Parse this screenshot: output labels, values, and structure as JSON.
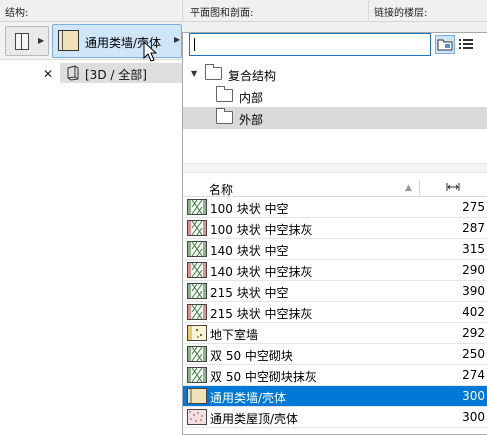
{
  "headers": {
    "structure": "结构:",
    "floorplan": "平面图和剖面:",
    "linked_stories": "链接的楼层:"
  },
  "toolbar": {
    "composite_name": "通用类墙/壳体"
  },
  "story": {
    "label": "[3D / 全部]"
  },
  "popup": {
    "search": {
      "value": "",
      "placeholder": ""
    },
    "tree": {
      "root": "复合结构",
      "children": [
        "内部",
        "外部"
      ],
      "selected": "外部"
    },
    "list": {
      "col_name": "名称",
      "col_thickness_icon": "thickness-icon",
      "selected_index": 9,
      "rows": [
        {
          "name": "100 块状 中空",
          "value": "275",
          "icon": "cross-hatch"
        },
        {
          "name": "100 块状 中空抹灰",
          "value": "287",
          "icon": "cross-hatch-red"
        },
        {
          "name": "140 块状 中空",
          "value": "315",
          "icon": "cross-hatch"
        },
        {
          "name": "140 块状 中空抹灰",
          "value": "290",
          "icon": "cross-hatch-red"
        },
        {
          "name": "215 块状 中空",
          "value": "390",
          "icon": "cross-hatch"
        },
        {
          "name": "215 块状 中空抹灰",
          "value": "402",
          "icon": "cross-hatch-red"
        },
        {
          "name": "地下室墙",
          "value": "292",
          "icon": "basement"
        },
        {
          "name": "双 50 中空砌块",
          "value": "250",
          "icon": "cross-hatch"
        },
        {
          "name": "双 50 中空砌块抹灰",
          "value": "274",
          "icon": "cross-hatch"
        },
        {
          "name": "通用类墙/壳体",
          "value": "300",
          "icon": "generic-wall"
        },
        {
          "name": "通用类屋顶/壳体",
          "value": "300",
          "icon": "generic-roof"
        }
      ]
    }
  },
  "colors": {
    "selection": "#0078d7",
    "focus_border": "#1a73c9",
    "composite_button": "#cfe5f8"
  }
}
